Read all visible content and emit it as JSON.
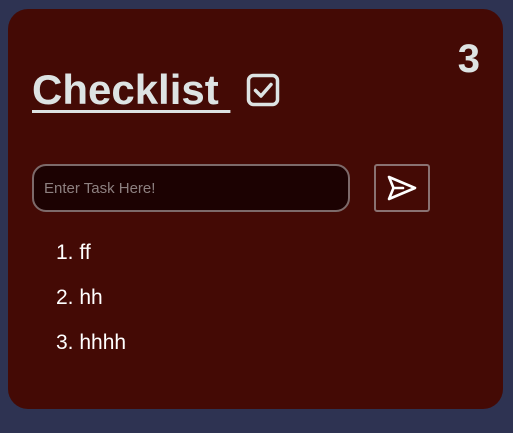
{
  "card": {
    "count": "3",
    "title": "Checklist ",
    "title_icon": "checkbox-checked-icon",
    "input": {
      "placeholder": "Enter Task Here!",
      "value": ""
    },
    "send_icon": "send-paper-plane-icon",
    "tasks": [
      {
        "number": "1.",
        "text": "ff"
      },
      {
        "number": "2.",
        "text": "hh"
      },
      {
        "number": "3.",
        "text": "hhhh"
      }
    ]
  },
  "colors": {
    "page_background": "#2e3352",
    "card_background": "#440a05",
    "title_text": "#dde3e3",
    "input_background": "#1c0202",
    "task_text": "#ffffff"
  }
}
